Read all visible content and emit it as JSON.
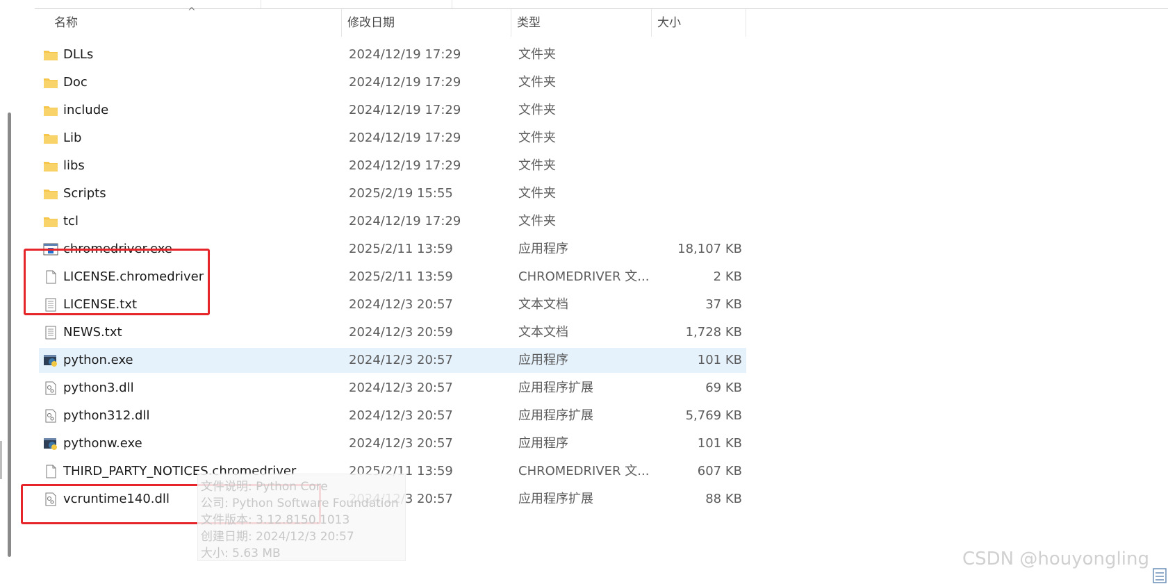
{
  "columns": {
    "name": "名称",
    "date": "修改日期",
    "type": "类型",
    "size": "大小",
    "sort_indicator": "^"
  },
  "files": [
    {
      "name": "DLLs",
      "date": "2024/12/19 17:29",
      "type": "文件夹",
      "size": "",
      "icon": "folder-icon"
    },
    {
      "name": "Doc",
      "date": "2024/12/19 17:29",
      "type": "文件夹",
      "size": "",
      "icon": "folder-icon"
    },
    {
      "name": "include",
      "date": "2024/12/19 17:29",
      "type": "文件夹",
      "size": "",
      "icon": "folder-icon"
    },
    {
      "name": "Lib",
      "date": "2024/12/19 17:29",
      "type": "文件夹",
      "size": "",
      "icon": "folder-icon"
    },
    {
      "name": "libs",
      "date": "2024/12/19 17:29",
      "type": "文件夹",
      "size": "",
      "icon": "folder-icon"
    },
    {
      "name": "Scripts",
      "date": "2025/2/19 15:55",
      "type": "文件夹",
      "size": "",
      "icon": "folder-icon"
    },
    {
      "name": "tcl",
      "date": "2024/12/19 17:29",
      "type": "文件夹",
      "size": "",
      "icon": "folder-icon"
    },
    {
      "name": "chromedriver.exe",
      "date": "2025/2/11 13:59",
      "type": "应用程序",
      "size": "18,107 KB",
      "icon": "application-icon"
    },
    {
      "name": "LICENSE.chromedriver",
      "date": "2025/2/11 13:59",
      "type": "CHROMEDRIVER 文...",
      "size": "2 KB",
      "icon": "file-icon"
    },
    {
      "name": "LICENSE.txt",
      "date": "2024/12/3 20:57",
      "type": "文本文档",
      "size": "37 KB",
      "icon": "text-file-icon"
    },
    {
      "name": "NEWS.txt",
      "date": "2024/12/3 20:59",
      "type": "文本文档",
      "size": "1,728 KB",
      "icon": "text-file-icon"
    },
    {
      "name": "python.exe",
      "date": "2024/12/3 20:57",
      "type": "应用程序",
      "size": "101 KB",
      "icon": "python-icon",
      "selected": true
    },
    {
      "name": "python3.dll",
      "date": "2024/12/3 20:57",
      "type": "应用程序扩展",
      "size": "69 KB",
      "icon": "dll-icon"
    },
    {
      "name": "python312.dll",
      "date": "2024/12/3 20:57",
      "type": "应用程序扩展",
      "size": "5,769 KB",
      "icon": "dll-icon"
    },
    {
      "name": "pythonw.exe",
      "date": "2024/12/3 20:57",
      "type": "应用程序",
      "size": "101 KB",
      "icon": "python-icon"
    },
    {
      "name": "THIRD_PARTY_NOTICES.chromedriver",
      "date": "2025/2/11 13:59",
      "type": "CHROMEDRIVER 文...",
      "size": "607 KB",
      "icon": "file-icon"
    },
    {
      "name": "vcruntime140.dll",
      "date": "2024/12/3 20:57",
      "type": "应用程序扩展",
      "size": "88 KB",
      "icon": "dll-icon"
    }
  ],
  "tooltip": {
    "description": "文件说明: Python Core",
    "company": "公司: Python Software Foundation",
    "version": "文件版本: 3.12.8150.1013",
    "created": "创建日期: 2024/12/3 20:57",
    "size": "大小: 5.63 MB"
  },
  "watermark": "CSDN @houyongling",
  "colors": {
    "highlight": "#e5252a",
    "selected_row": "#e5f1fb",
    "folder": "#f5c64b"
  }
}
